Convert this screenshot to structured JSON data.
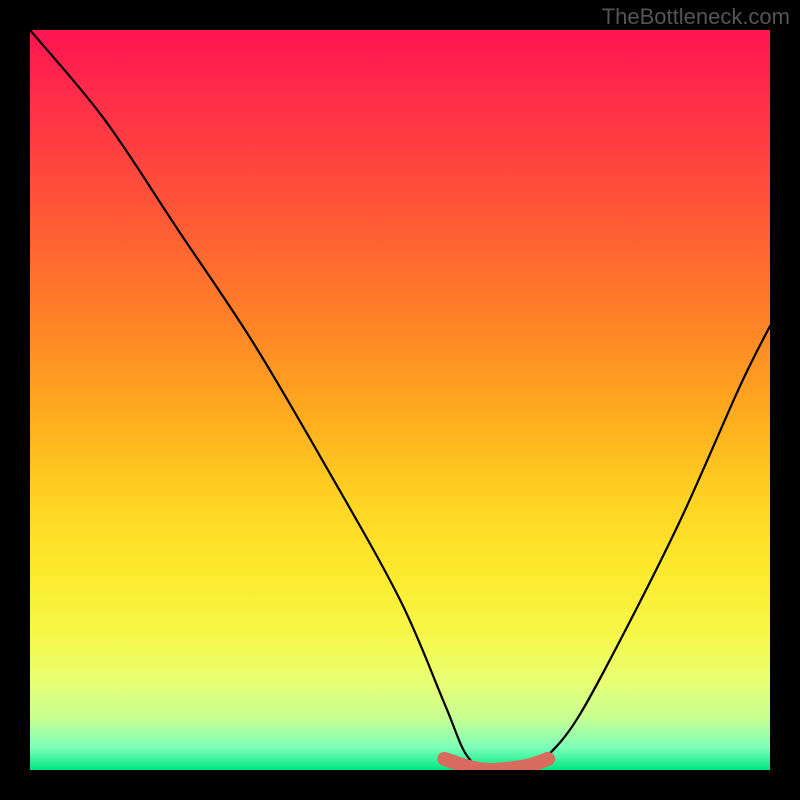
{
  "watermark": "TheBottleneck.com",
  "chart_data": {
    "type": "line",
    "title": "",
    "xlabel": "",
    "ylabel": "",
    "xlim": [
      0,
      100
    ],
    "ylim": [
      0,
      100
    ],
    "grid": false,
    "legend": false,
    "series": [
      {
        "name": "curve",
        "color": "#000000",
        "x": [
          0,
          10,
          20,
          30,
          40,
          50,
          56,
          59,
          62,
          67,
          70,
          74,
          80,
          88,
          96,
          100
        ],
        "y": [
          100,
          88,
          73,
          58,
          41,
          23,
          9,
          2,
          0,
          0,
          2,
          7,
          18,
          34,
          52,
          60
        ]
      },
      {
        "name": "highlight",
        "color": "#d96b5e",
        "x": [
          56,
          59,
          62,
          67,
          70
        ],
        "y": [
          1.5,
          0.5,
          0,
          0.5,
          1.5
        ]
      }
    ],
    "gradient_stops": [
      {
        "pos": 0,
        "color": "#ff1452"
      },
      {
        "pos": 8,
        "color": "#ff2a4a"
      },
      {
        "pos": 24,
        "color": "#ff5537"
      },
      {
        "pos": 40,
        "color": "#ff8426"
      },
      {
        "pos": 54,
        "color": "#ffb21e"
      },
      {
        "pos": 64,
        "color": "#ffd523"
      },
      {
        "pos": 74,
        "color": "#fceb2f"
      },
      {
        "pos": 82,
        "color": "#f6f84a"
      },
      {
        "pos": 88,
        "color": "#e9ff73"
      },
      {
        "pos": 93,
        "color": "#c6ff92"
      },
      {
        "pos": 97,
        "color": "#7cffba"
      },
      {
        "pos": 100,
        "color": "#00e680"
      }
    ]
  }
}
